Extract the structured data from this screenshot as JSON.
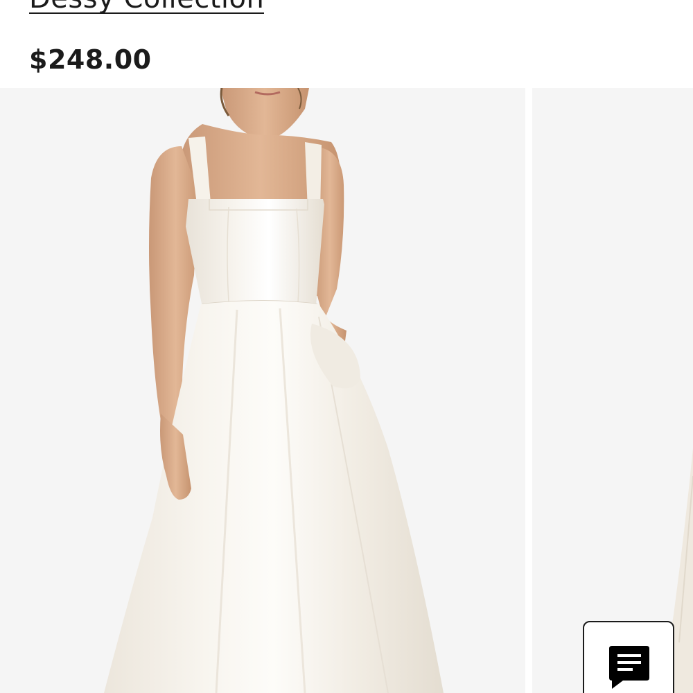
{
  "product": {
    "brand_link": "Dessy Collection",
    "price": "$248.00"
  },
  "gallery": {
    "images": [
      {
        "name": "main-dress-image",
        "alt": ""
      },
      {
        "name": "next-dress-image",
        "alt": ""
      }
    ]
  },
  "chat": {
    "icon": "chat-icon"
  },
  "colors": {
    "text": "#1b1b1b",
    "image_background": "#f5f5f5",
    "dress": "#f4f0e9"
  }
}
